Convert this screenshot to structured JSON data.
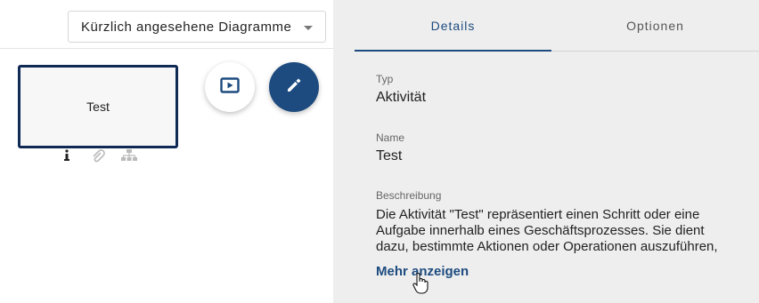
{
  "diagram_select": {
    "value": "Kürzlich angesehene Diagramme"
  },
  "canvas": {
    "activity_label": "Test",
    "fab_play_icon": "play-presentation-icon",
    "fab_edit_icon": "pencil-icon",
    "attribute_icons": [
      "info-icon",
      "attachment-icon",
      "hierarchy-icon"
    ]
  },
  "tabs": [
    {
      "label": "Details",
      "active": true
    },
    {
      "label": "Optionen",
      "active": false
    }
  ],
  "details": {
    "type_label": "Typ",
    "type_value": "Aktivität",
    "name_label": "Name",
    "name_value": "Test",
    "description_label": "Beschreibung",
    "description_lines": [
      "Die Aktivität \"Test\" repräsentiert einen Schritt oder eine",
      "Aufgabe innerhalb eines Geschäftsprozesses. Sie dient",
      "dazu, bestimmte Aktionen oder Operationen auszuführen,"
    ],
    "more_link": "Mehr anzeigen"
  },
  "colors": {
    "accent": "#1d4b7f",
    "shape_border": "#0f2a55",
    "pane_bg": "#eeeeee"
  }
}
